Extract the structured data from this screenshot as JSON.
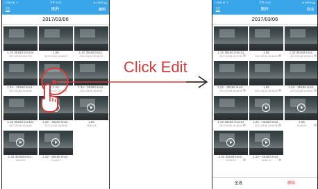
{
  "callout": "Click Edit",
  "before": {
    "status": {
      "left": "□ SIM ★ ↗",
      "center": "下午 3:42",
      "right": "● 100% ▬"
    },
    "nav_title": "图片",
    "nav_action": "编辑",
    "date": "2017/03/06",
    "items": [
      {
        "cap1": "1.32 3518d imx124",
        "cap2": "2017-03-06 15:47:02",
        "video": false
      },
      {
        "cap1": "1.65",
        "cap2": "2017-03-06 15:46:23",
        "video": false
      },
      {
        "cap1": "1.32 3518d imx2..",
        "cap2": "2017-03-06 15:46:19",
        "video": false
      },
      {
        "cap1": "1.22-- 3518d imx2..",
        "cap2": "2017-03-06 15:46:05",
        "video": false
      },
      {
        "cap1": "1.65",
        "cap2": "2017-03-06 15:46:05",
        "video": false
      },
      {
        "cap1": "1.22-- 3518d imx2..",
        "cap2": "2017-03-06 15:46:01",
        "video": false
      },
      {
        "cap1": "1.32 3518d imx124",
        "cap2": "2017-03-06 15:46:00",
        "video": false
      },
      {
        "cap1": "1.22-- 3518d imx2..",
        "cap2": "2017-03-06 15:45:55",
        "video": true
      },
      {
        "cap1": "1.65",
        "cap2": "15:46:23",
        "video": true
      },
      {
        "cap1": "1.32 3518d imx2..",
        "cap2": "15:46:22",
        "video": true
      },
      {
        "cap1": "1.22-- 3518d imx2..",
        "cap2": "15:46:21",
        "video": true
      }
    ]
  },
  "after": {
    "status": {
      "left": "□ SIM ★ ↗",
      "center": "下午 3:42",
      "right": "● 100% ▬"
    },
    "nav_title": "图片",
    "nav_action": "取消",
    "date": "2017/03/06",
    "select_all": "全选",
    "delete": "删除",
    "items": [
      {
        "cap1": "1.32 3518d imx124",
        "cap2": "2017-03-06 15:47:02",
        "video": false
      },
      {
        "cap1": "1.65",
        "cap2": "2017-03-06 15:46:23",
        "video": false
      },
      {
        "cap1": "1.32 3518d imx2..",
        "cap2": "2017-03-06 15:46:19",
        "video": false
      },
      {
        "cap1": "1.22-- 3518d imx2..",
        "cap2": "2017-03-06 15:46:05",
        "video": false
      },
      {
        "cap1": "1.65",
        "cap2": "2017-03-06 15:46:05",
        "video": false
      },
      {
        "cap1": "1.22-- 3518d imx2..",
        "cap2": "2017-03-06 15:46:01",
        "video": false
      },
      {
        "cap1": "1.32 3518d imx124",
        "cap2": "2017-03-06 15:46:00",
        "video": false
      },
      {
        "cap1": "1.22-- 3518d imx2..",
        "cap2": "2017-03-06 15:45:55",
        "video": true
      },
      {
        "cap1": "1.65",
        "cap2": "15:46:23",
        "video": true
      },
      {
        "cap1": "1.32 3518d imx2..",
        "cap2": "15:46:22",
        "video": true
      },
      {
        "cap1": "1.22-- 3518d imx2..",
        "cap2": "15:46:21",
        "video": true
      }
    ]
  }
}
